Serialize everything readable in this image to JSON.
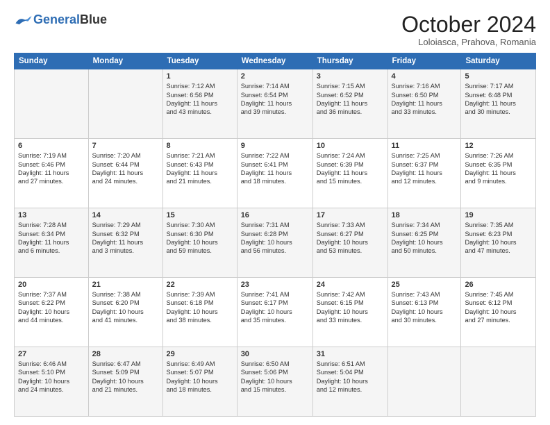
{
  "logo": {
    "line1": "General",
    "line2": "Blue"
  },
  "title": "October 2024",
  "subtitle": "Loloiasca, Prahova, Romania",
  "headers": [
    "Sunday",
    "Monday",
    "Tuesday",
    "Wednesday",
    "Thursday",
    "Friday",
    "Saturday"
  ],
  "weeks": [
    [
      {
        "day": "",
        "lines": []
      },
      {
        "day": "",
        "lines": []
      },
      {
        "day": "1",
        "lines": [
          "Sunrise: 7:12 AM",
          "Sunset: 6:56 PM",
          "Daylight: 11 hours",
          "and 43 minutes."
        ]
      },
      {
        "day": "2",
        "lines": [
          "Sunrise: 7:14 AM",
          "Sunset: 6:54 PM",
          "Daylight: 11 hours",
          "and 39 minutes."
        ]
      },
      {
        "day": "3",
        "lines": [
          "Sunrise: 7:15 AM",
          "Sunset: 6:52 PM",
          "Daylight: 11 hours",
          "and 36 minutes."
        ]
      },
      {
        "day": "4",
        "lines": [
          "Sunrise: 7:16 AM",
          "Sunset: 6:50 PM",
          "Daylight: 11 hours",
          "and 33 minutes."
        ]
      },
      {
        "day": "5",
        "lines": [
          "Sunrise: 7:17 AM",
          "Sunset: 6:48 PM",
          "Daylight: 11 hours",
          "and 30 minutes."
        ]
      }
    ],
    [
      {
        "day": "6",
        "lines": [
          "Sunrise: 7:19 AM",
          "Sunset: 6:46 PM",
          "Daylight: 11 hours",
          "and 27 minutes."
        ]
      },
      {
        "day": "7",
        "lines": [
          "Sunrise: 7:20 AM",
          "Sunset: 6:44 PM",
          "Daylight: 11 hours",
          "and 24 minutes."
        ]
      },
      {
        "day": "8",
        "lines": [
          "Sunrise: 7:21 AM",
          "Sunset: 6:43 PM",
          "Daylight: 11 hours",
          "and 21 minutes."
        ]
      },
      {
        "day": "9",
        "lines": [
          "Sunrise: 7:22 AM",
          "Sunset: 6:41 PM",
          "Daylight: 11 hours",
          "and 18 minutes."
        ]
      },
      {
        "day": "10",
        "lines": [
          "Sunrise: 7:24 AM",
          "Sunset: 6:39 PM",
          "Daylight: 11 hours",
          "and 15 minutes."
        ]
      },
      {
        "day": "11",
        "lines": [
          "Sunrise: 7:25 AM",
          "Sunset: 6:37 PM",
          "Daylight: 11 hours",
          "and 12 minutes."
        ]
      },
      {
        "day": "12",
        "lines": [
          "Sunrise: 7:26 AM",
          "Sunset: 6:35 PM",
          "Daylight: 11 hours",
          "and 9 minutes."
        ]
      }
    ],
    [
      {
        "day": "13",
        "lines": [
          "Sunrise: 7:28 AM",
          "Sunset: 6:34 PM",
          "Daylight: 11 hours",
          "and 6 minutes."
        ]
      },
      {
        "day": "14",
        "lines": [
          "Sunrise: 7:29 AM",
          "Sunset: 6:32 PM",
          "Daylight: 11 hours",
          "and 3 minutes."
        ]
      },
      {
        "day": "15",
        "lines": [
          "Sunrise: 7:30 AM",
          "Sunset: 6:30 PM",
          "Daylight: 10 hours",
          "and 59 minutes."
        ]
      },
      {
        "day": "16",
        "lines": [
          "Sunrise: 7:31 AM",
          "Sunset: 6:28 PM",
          "Daylight: 10 hours",
          "and 56 minutes."
        ]
      },
      {
        "day": "17",
        "lines": [
          "Sunrise: 7:33 AM",
          "Sunset: 6:27 PM",
          "Daylight: 10 hours",
          "and 53 minutes."
        ]
      },
      {
        "day": "18",
        "lines": [
          "Sunrise: 7:34 AM",
          "Sunset: 6:25 PM",
          "Daylight: 10 hours",
          "and 50 minutes."
        ]
      },
      {
        "day": "19",
        "lines": [
          "Sunrise: 7:35 AM",
          "Sunset: 6:23 PM",
          "Daylight: 10 hours",
          "and 47 minutes."
        ]
      }
    ],
    [
      {
        "day": "20",
        "lines": [
          "Sunrise: 7:37 AM",
          "Sunset: 6:22 PM",
          "Daylight: 10 hours",
          "and 44 minutes."
        ]
      },
      {
        "day": "21",
        "lines": [
          "Sunrise: 7:38 AM",
          "Sunset: 6:20 PM",
          "Daylight: 10 hours",
          "and 41 minutes."
        ]
      },
      {
        "day": "22",
        "lines": [
          "Sunrise: 7:39 AM",
          "Sunset: 6:18 PM",
          "Daylight: 10 hours",
          "and 38 minutes."
        ]
      },
      {
        "day": "23",
        "lines": [
          "Sunrise: 7:41 AM",
          "Sunset: 6:17 PM",
          "Daylight: 10 hours",
          "and 35 minutes."
        ]
      },
      {
        "day": "24",
        "lines": [
          "Sunrise: 7:42 AM",
          "Sunset: 6:15 PM",
          "Daylight: 10 hours",
          "and 33 minutes."
        ]
      },
      {
        "day": "25",
        "lines": [
          "Sunrise: 7:43 AM",
          "Sunset: 6:13 PM",
          "Daylight: 10 hours",
          "and 30 minutes."
        ]
      },
      {
        "day": "26",
        "lines": [
          "Sunrise: 7:45 AM",
          "Sunset: 6:12 PM",
          "Daylight: 10 hours",
          "and 27 minutes."
        ]
      }
    ],
    [
      {
        "day": "27",
        "lines": [
          "Sunrise: 6:46 AM",
          "Sunset: 5:10 PM",
          "Daylight: 10 hours",
          "and 24 minutes."
        ]
      },
      {
        "day": "28",
        "lines": [
          "Sunrise: 6:47 AM",
          "Sunset: 5:09 PM",
          "Daylight: 10 hours",
          "and 21 minutes."
        ]
      },
      {
        "day": "29",
        "lines": [
          "Sunrise: 6:49 AM",
          "Sunset: 5:07 PM",
          "Daylight: 10 hours",
          "and 18 minutes."
        ]
      },
      {
        "day": "30",
        "lines": [
          "Sunrise: 6:50 AM",
          "Sunset: 5:06 PM",
          "Daylight: 10 hours",
          "and 15 minutes."
        ]
      },
      {
        "day": "31",
        "lines": [
          "Sunrise: 6:51 AM",
          "Sunset: 5:04 PM",
          "Daylight: 10 hours",
          "and 12 minutes."
        ]
      },
      {
        "day": "",
        "lines": []
      },
      {
        "day": "",
        "lines": []
      }
    ]
  ]
}
